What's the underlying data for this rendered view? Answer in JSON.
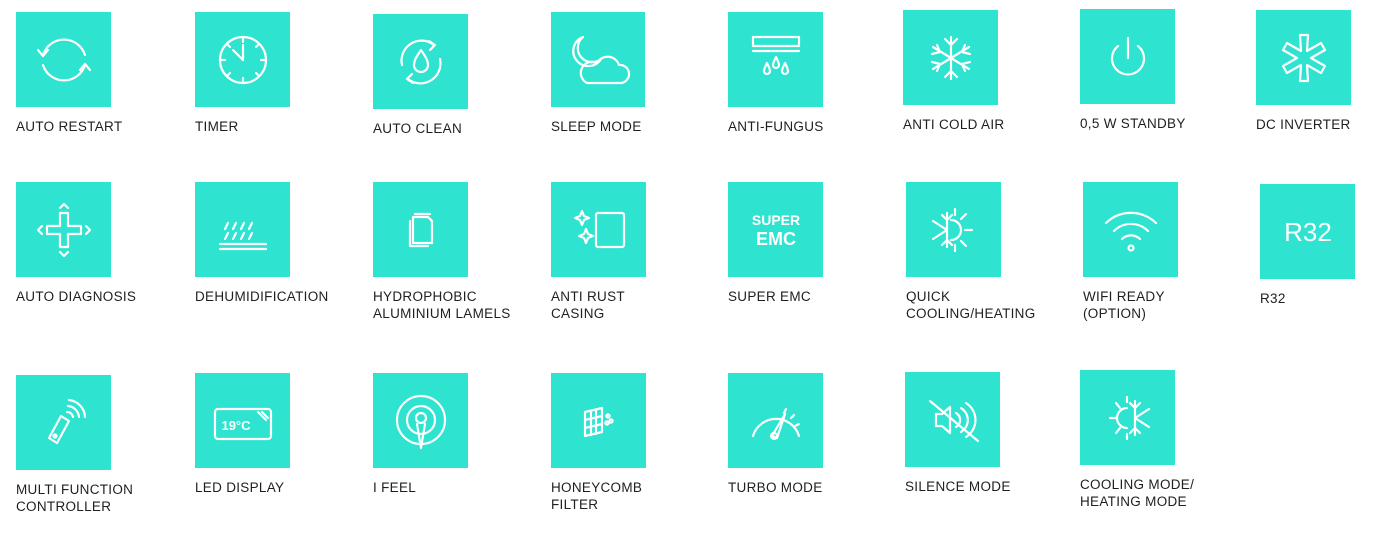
{
  "accent_color": "#2ee3d0",
  "features": [
    {
      "label": "AUTO RESTART",
      "icon": "auto-restart-icon"
    },
    {
      "label": "TIMER",
      "icon": "timer-icon"
    },
    {
      "label": "AUTO CLEAN",
      "icon": "auto-clean-icon"
    },
    {
      "label": "SLEEP MODE",
      "icon": "sleep-mode-icon"
    },
    {
      "label": "ANTI-FUNGUS",
      "icon": "anti-fungus-icon"
    },
    {
      "label": "ANTI COLD AIR",
      "icon": "anti-cold-air-icon"
    },
    {
      "label": "0,5 W STANDBY",
      "icon": "standby-power-icon"
    },
    {
      "label": "DC INVERTER",
      "icon": "dc-inverter-icon"
    },
    {
      "label": "AUTO DIAGNOSIS",
      "icon": "auto-diagnosis-icon"
    },
    {
      "label": "DEHUMIDIFICATION",
      "icon": "dehumidification-icon"
    },
    {
      "label": "HYDROPHOBIC\nALUMINIUM LAMELS",
      "icon": "hydrophobic-lamels-icon"
    },
    {
      "label": "ANTI RUST\nCASING",
      "icon": "anti-rust-icon"
    },
    {
      "label": "SUPER EMC",
      "icon": "super-emc-icon",
      "icon_text": [
        "SUPER",
        "EMC"
      ]
    },
    {
      "label": "QUICK\nCOOLING/HEATING",
      "icon": "quick-cooling-heating-icon"
    },
    {
      "label": "WIFI READY\n(OPTION)",
      "icon": "wifi-icon"
    },
    {
      "label": "R32",
      "icon": "r32-icon",
      "icon_text": [
        "R32"
      ]
    },
    {
      "label": "MULTI FUNCTION\nCONTROLLER",
      "icon": "remote-controller-icon"
    },
    {
      "label": "LED DISPLAY",
      "icon": "led-display-icon",
      "icon_text": [
        "19°C"
      ]
    },
    {
      "label": "I FEEL",
      "icon": "i-feel-icon"
    },
    {
      "label": "HONEYCOMB\nFILTER",
      "icon": "honeycomb-filter-icon"
    },
    {
      "label": "TURBO MODE",
      "icon": "turbo-mode-icon"
    },
    {
      "label": "SILENCE MODE",
      "icon": "silence-mode-icon"
    },
    {
      "label": "COOLING MODE/\nHEATING MODE",
      "icon": "cooling-heating-mode-icon"
    }
  ]
}
